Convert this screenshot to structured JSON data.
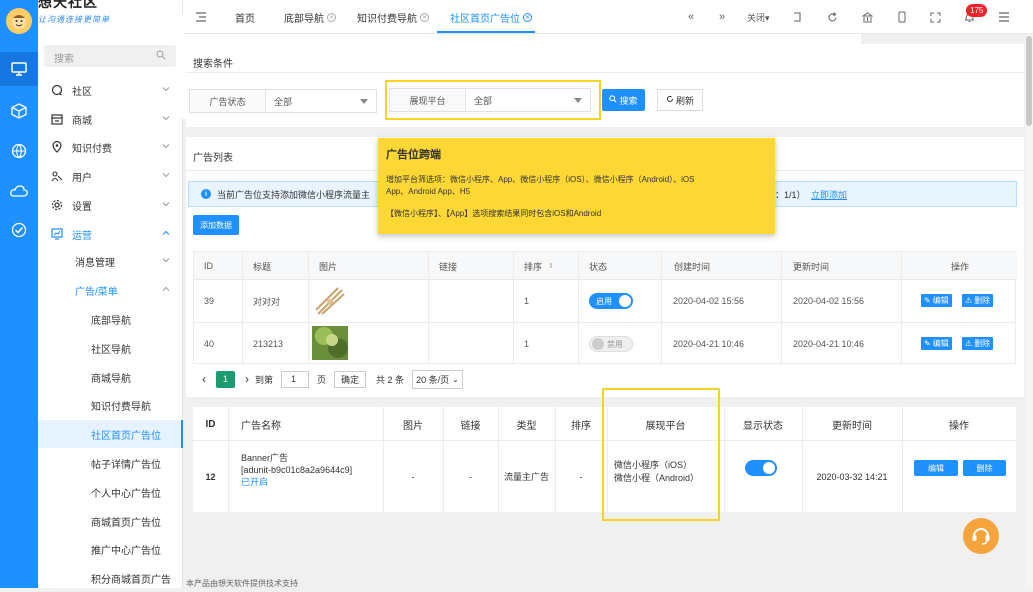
{
  "app": {
    "logo_title": "想天社区",
    "logo_slogan": "让沟通连接更简单"
  },
  "sidebar": {
    "search_placeholder": "搜索",
    "menu": [
      {
        "label": "社区"
      },
      {
        "label": "商城"
      },
      {
        "label": "知识付费"
      },
      {
        "label": "用户"
      },
      {
        "label": "设置"
      },
      {
        "label": "运营"
      }
    ],
    "sub_menu": {
      "label": "消息管理"
    },
    "ad_menu": {
      "label": "广告/菜单"
    },
    "ad_items": [
      {
        "label": "底部导航"
      },
      {
        "label": "社区导航"
      },
      {
        "label": "商城导航"
      },
      {
        "label": "知识付费导航"
      },
      {
        "label": "社区首页广告位"
      },
      {
        "label": "帖子详情广告位"
      },
      {
        "label": "个人中心广告位"
      },
      {
        "label": "商城首页广告位"
      },
      {
        "label": "推广中心广告位"
      },
      {
        "label": "积分商城首页广告"
      }
    ]
  },
  "topbar": {
    "tabs": [
      {
        "label": "首页"
      },
      {
        "label": "底部导航"
      },
      {
        "label": "知识付费导航"
      },
      {
        "label": "社区首页广告位"
      }
    ],
    "close_label": "关闭",
    "badge_count": "175"
  },
  "search": {
    "title": "搜索条件",
    "status_label": "广告状态",
    "status_value": "全部",
    "platform_label": "展现平台",
    "platform_value": "全部",
    "search_btn": "搜索",
    "refresh_btn": "刷新"
  },
  "tooltip": {
    "title": "广告位跨端",
    "line1": "增加平台筛选项：微信小程序、App、微信小程序（iOS）、微信小程序（Android）、iOS",
    "line2": "App、Android App、H5",
    "line3": "【微信小程序】、【App】选项搜索结果同时包含iOS和Android"
  },
  "list": {
    "title": "广告列表",
    "notice": "当前广告位支持添加微信小程序流量主",
    "notice_tail": "：1/1）",
    "notice_link": "立即添加",
    "add_btn": "添加数据",
    "headers": [
      "ID",
      "标题",
      "图片",
      "链接",
      "排序",
      "状态",
      "创建时间",
      "更新时间",
      "操作"
    ],
    "rows": [
      {
        "id": "39",
        "title": "对对对",
        "link": "",
        "sort": "1",
        "status": "启用",
        "created": "2020-04-02 15:56",
        "updated": "2020-04-02 15:56"
      },
      {
        "id": "40",
        "title": "213213",
        "link": "",
        "sort": "1",
        "status": "禁用",
        "created": "2020-04-21 10:46",
        "updated": "2020-04-21 10:46"
      }
    ],
    "edit_label": "编辑",
    "delete_label": "删除"
  },
  "pager": {
    "current": "1",
    "goto_label": "到第",
    "goto_value": "1",
    "page_unit": "页",
    "confirm": "确定",
    "total": "共 2 条",
    "page_size": "20 条/页"
  },
  "table2": {
    "headers": [
      "ID",
      "广告名称",
      "图片",
      "链接",
      "类型",
      "排序",
      "展现平台",
      "显示状态",
      "更新时间",
      "操作"
    ],
    "row": {
      "id": "12",
      "name_line1": "Banner广告",
      "name_line2": "[adunit-b9c01c8a2a9644c9]",
      "name_status": "已开启",
      "image": "-",
      "link": "-",
      "type": "流量主广告",
      "sort": "-",
      "platform_line1": "微信小程序（iOS）",
      "platform_line2": "微信小程（Android）",
      "updated": "2020-03-32 14:21",
      "edit": "编辑",
      "delete": "删除"
    }
  },
  "footer": {
    "text": "本产品由想天软件提供技术支持"
  },
  "colors": {
    "primary": "#1e90ff",
    "highlight": "#f5d327",
    "tooltip_bg": "#fdd835"
  }
}
